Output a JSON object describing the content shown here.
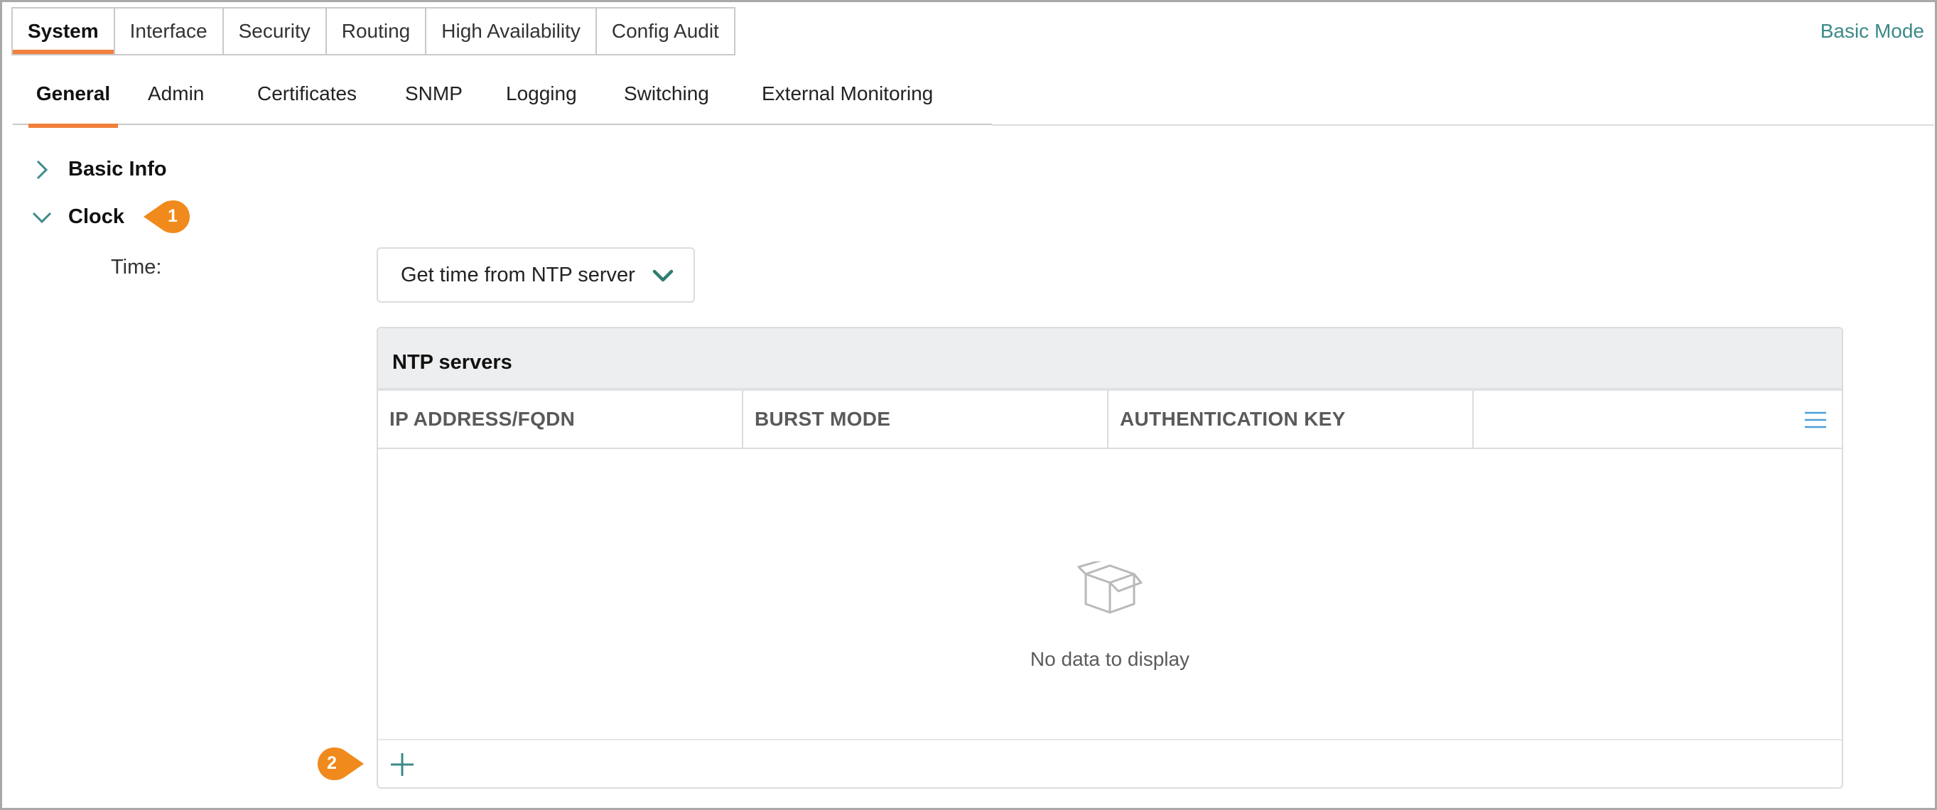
{
  "top_tabs": [
    {
      "label": "System",
      "active": true
    },
    {
      "label": "Interface"
    },
    {
      "label": "Security"
    },
    {
      "label": "Routing"
    },
    {
      "label": "High Availability"
    },
    {
      "label": "Config Audit"
    }
  ],
  "mode_link": "Basic Mode",
  "sub_tabs": [
    {
      "label": "General",
      "active": true
    },
    {
      "label": "Admin"
    },
    {
      "label": "Certificates"
    },
    {
      "label": "SNMP"
    },
    {
      "label": "Logging"
    },
    {
      "label": "Switching"
    },
    {
      "label": "External Monitoring"
    }
  ],
  "sections": {
    "basic_info": {
      "title": "Basic Info",
      "expanded": false
    },
    "clock": {
      "title": "Clock",
      "expanded": true
    }
  },
  "callouts": {
    "one": "1",
    "two": "2"
  },
  "clock": {
    "time_label": "Time:",
    "time_source": "Get time from NTP server"
  },
  "ntp_table": {
    "title": "NTP servers",
    "columns": [
      "IP ADDRESS/FQDN",
      "BURST MODE",
      "AUTHENTICATION KEY"
    ],
    "empty_text": "No data to display"
  },
  "icons": {
    "collapsed": "chevron-right-icon",
    "expanded": "chevron-down-icon",
    "column_menu": "hamburger-menu-icon",
    "empty": "empty-box-icon",
    "add": "plus-icon"
  },
  "colors": {
    "accent_orange": "#f0803c",
    "teal": "#3c8a88"
  }
}
